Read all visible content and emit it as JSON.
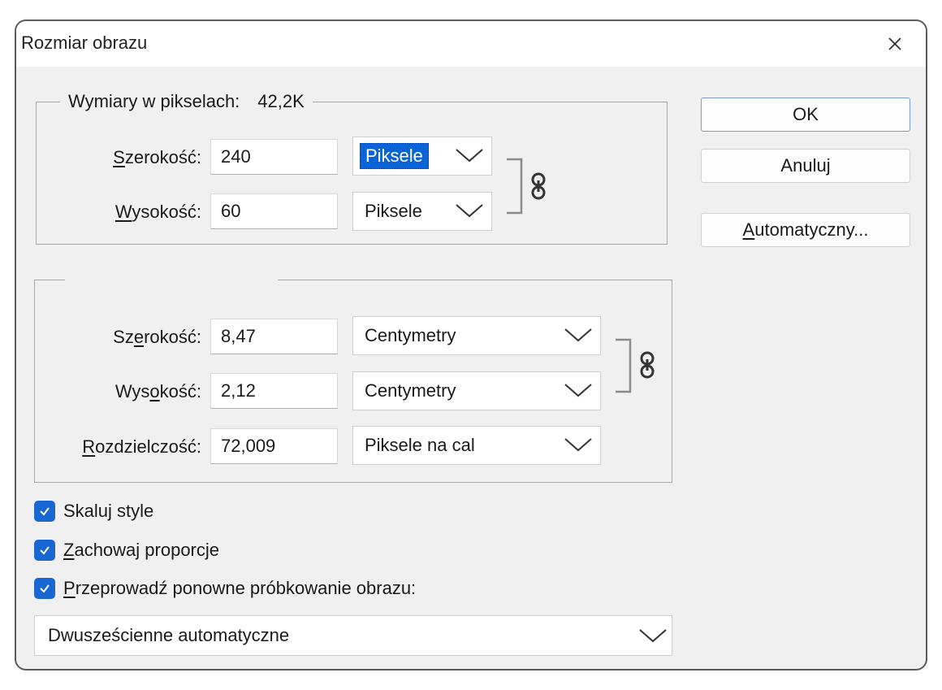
{
  "dialog": {
    "title": "Rozmiar obrazu"
  },
  "pixel_dimensions": {
    "legend": "Wymiary w pikselach:",
    "size": "42,2K",
    "width_label_u": "S",
    "width_label_rest": "zerokość:",
    "width_value": "240",
    "width_unit": "Piksele",
    "height_label_u": "W",
    "height_label_rest": "ysokość:",
    "height_value": "60",
    "height_unit": "Piksele"
  },
  "document_size": {
    "width_label_a": "Sz",
    "width_label_u": "e",
    "width_label_b": "rokość:",
    "width_value": "8,47",
    "width_unit": "Centymetry",
    "height_label_a": "Wys",
    "height_label_u": "o",
    "height_label_b": "kość:",
    "height_value": "2,12",
    "height_unit": "Centymetry",
    "resolution_label_u": "R",
    "resolution_label_rest": "ozdzielczość:",
    "resolution_value": "72,009",
    "resolution_unit": "Piksele na cal"
  },
  "buttons": {
    "ok": "OK",
    "cancel": "Anuluj",
    "auto_u": "A",
    "auto_rest": "utomatyczny..."
  },
  "options": {
    "scale_styles": "Skaluj style",
    "constrain_u": "Z",
    "constrain_rest": "achowaj proporcje",
    "resample_u": "P",
    "resample_rest": "rzeprowadź ponowne próbkowanie obrazu:",
    "resample_method": "Dwusześcienne automatyczne"
  },
  "colors": {
    "accent": "#1967d2",
    "dialog_bg": "#f0f0f0",
    "selection": "#0a64d8"
  }
}
